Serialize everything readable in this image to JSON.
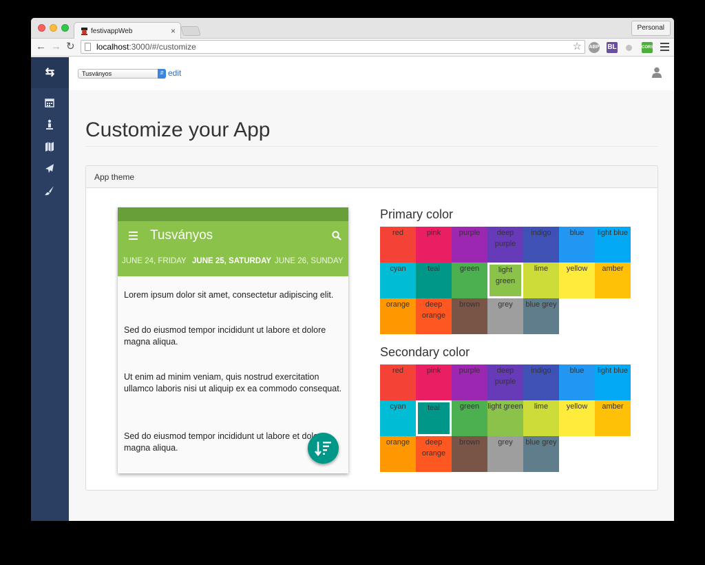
{
  "browser": {
    "tab_title": "festivappWeb",
    "tab_close": "×",
    "profile": "Personal",
    "url_host": "localhost",
    "url_rest": ":3000/#/customize",
    "bookmark_icon": "star-icon",
    "ext_abp": "ABP",
    "ext_bl": "BL",
    "ext_cors": "CORS"
  },
  "sidebar": {
    "brand_icon": "exchange-icon",
    "items": [
      "calendar-icon",
      "person-icon",
      "map-icon",
      "paper-plane-icon",
      "paint-brush-icon"
    ]
  },
  "header": {
    "festival": "Tusványos",
    "edit_label": "edit"
  },
  "page": {
    "title": "Customize your App",
    "panel_title": "App theme"
  },
  "preview": {
    "app_title": "Tusványos",
    "tabs": [
      "JUNE 24, FRIDAY",
      "JUNE 25, SATURDAY",
      "JUNE 26, SUNDAY"
    ],
    "active_tab": 1,
    "paragraphs": [
      "Lorem ipsum dolor sit amet, consectetur adipiscing elit.",
      "Sed do eiusmod tempor incididunt ut labore et dolore magna aliqua.",
      "Ut enim ad minim veniam, quis nostrud exercitation ullamco laboris nisi ut aliquip ex ea commodo consequat.",
      "Sed do eiusmod tempor incididunt ut labore et dolore magna aliqua."
    ],
    "colors": {
      "status": "#689f38",
      "toolbar": "#8bc34a",
      "fab": "#009688"
    }
  },
  "primary": {
    "title": "Primary color",
    "selected": "light green"
  },
  "secondary": {
    "title": "Secondary color",
    "selected": "teal"
  },
  "palette": [
    {
      "name": "red",
      "label": "red",
      "hex": "#f44336"
    },
    {
      "name": "pink",
      "label": "pink",
      "hex": "#e91e63"
    },
    {
      "name": "purple",
      "label": "purple",
      "hex": "#9c27b0"
    },
    {
      "name": "deep purple",
      "label": "deep purple",
      "hex": "#673ab7"
    },
    {
      "name": "indigo",
      "label": "indigo",
      "hex": "#3f51b5"
    },
    {
      "name": "blue",
      "label": "blue",
      "hex": "#2196f3"
    },
    {
      "name": "light blue",
      "label": "light blue",
      "hex": "#03a9f4"
    },
    {
      "name": "cyan",
      "label": "cyan",
      "hex": "#00bcd4"
    },
    {
      "name": "teal",
      "label": "teal",
      "hex": "#009688"
    },
    {
      "name": "green",
      "label": "green",
      "hex": "#4caf50"
    },
    {
      "name": "light green",
      "label": "light green",
      "hex": "#8bc34a"
    },
    {
      "name": "lime",
      "label": "lime",
      "hex": "#cddc39"
    },
    {
      "name": "yellow",
      "label": "yellow",
      "hex": "#ffeb3b"
    },
    {
      "name": "amber",
      "label": "amber",
      "hex": "#ffc107"
    },
    {
      "name": "orange",
      "label": "orange",
      "hex": "#ff9800"
    },
    {
      "name": "deep orange",
      "label": "deep orange",
      "hex": "#ff5722"
    },
    {
      "name": "brown",
      "label": "brown",
      "hex": "#795548"
    },
    {
      "name": "grey",
      "label": "grey",
      "hex": "#9e9e9e"
    },
    {
      "name": "blue grey",
      "label": "blue grey",
      "hex": "#607d8b"
    }
  ]
}
